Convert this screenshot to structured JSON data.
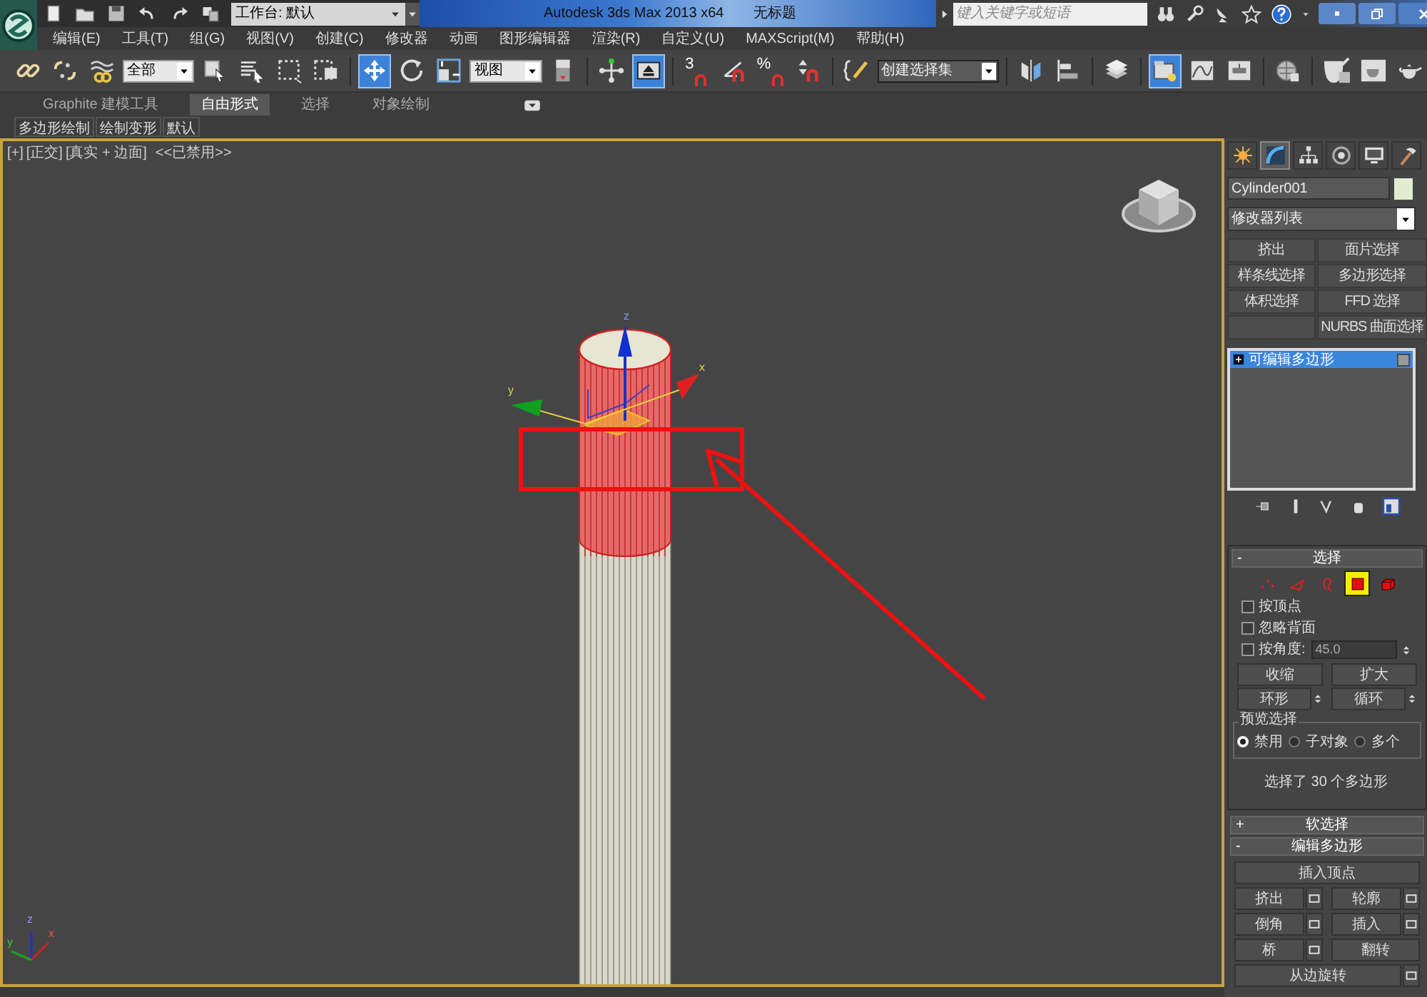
{
  "title_bar": {
    "workspace": "工作台: 默认",
    "app_title": "Autodesk 3ds Max  2013 x64",
    "document": "无标题",
    "search_placeholder": "键入关键字或短语"
  },
  "menu": [
    "编辑(E)",
    "工具(T)",
    "组(G)",
    "视图(V)",
    "创建(C)",
    "修改器",
    "动画",
    "图形编辑器",
    "渲染(R)",
    "自定义(U)",
    "MAXScript(M)",
    "帮助(H)"
  ],
  "toolbar": [
    {
      "kind": "link",
      "selected": false
    },
    {
      "kind": "unlink",
      "selected": false
    },
    {
      "kind": "bind",
      "selected": false
    },
    {
      "kind": "dropdown",
      "value": "全部"
    },
    {
      "kind": "select",
      "selected": false
    },
    {
      "kind": "select-name",
      "selected": false
    },
    {
      "kind": "rect-region",
      "selected": false
    },
    {
      "kind": "window-crossing",
      "selected": false
    },
    {
      "kind": "separator"
    },
    {
      "kind": "move",
      "selected": true
    },
    {
      "kind": "rotate",
      "selected": false
    },
    {
      "kind": "scale",
      "selected": false
    },
    {
      "kind": "dropdown",
      "value": "视图"
    },
    {
      "kind": "pivot",
      "selected": false
    },
    {
      "kind": "separator"
    },
    {
      "kind": "manipulate",
      "selected": false
    },
    {
      "kind": "keyboard",
      "selected": true
    },
    {
      "kind": "separator"
    },
    {
      "kind": "snap",
      "text": "3",
      "selected": false
    },
    {
      "kind": "angle-snap",
      "selected": false
    },
    {
      "kind": "snap",
      "text": "%",
      "selected": false
    },
    {
      "kind": "spinner-snap",
      "selected": false
    },
    {
      "kind": "separator"
    },
    {
      "kind": "named-sel",
      "selected": false
    },
    {
      "kind": "set-dropdown",
      "value": "创建选择集"
    },
    {
      "kind": "separator"
    },
    {
      "kind": "mirror",
      "selected": false
    },
    {
      "kind": "align",
      "selected": false
    },
    {
      "kind": "separator"
    },
    {
      "kind": "layer",
      "selected": false
    },
    {
      "kind": "separator"
    },
    {
      "kind": "scene-explorer",
      "selected": true
    },
    {
      "kind": "curve",
      "selected": false
    },
    {
      "kind": "schematic",
      "selected": false
    },
    {
      "kind": "separator"
    },
    {
      "kind": "material",
      "selected": false
    },
    {
      "kind": "separator"
    },
    {
      "kind": "render-setup",
      "selected": false
    },
    {
      "kind": "frame-window",
      "selected": false
    },
    {
      "kind": "render",
      "selected": false
    }
  ],
  "ribbon": {
    "tabs": [
      {
        "label": "Graphite 建模工具",
        "selected": false
      },
      {
        "label": "自由形式",
        "selected": true
      },
      {
        "label": "选择",
        "selected": false
      },
      {
        "label": "对象绘制",
        "selected": false
      }
    ],
    "subtabs": [
      "多边形绘制",
      "绘制变形",
      "默认"
    ]
  },
  "viewport": {
    "labels": [
      "[+]",
      "[正交]",
      "[真实 + 边面]",
      "<<已禁用>>"
    ],
    "gizmo_labels": [
      "x",
      "y",
      "z"
    ],
    "tripod_labels": [
      "x",
      "y",
      "z"
    ]
  },
  "command_panel": {
    "tabs": [
      {
        "kind": "create",
        "selected": false
      },
      {
        "kind": "modify",
        "selected": true
      },
      {
        "kind": "hierarchy",
        "selected": false
      },
      {
        "kind": "motion",
        "selected": false
      },
      {
        "kind": "display",
        "selected": false
      },
      {
        "kind": "utilities",
        "selected": false
      }
    ],
    "object_name": "Cylinder001",
    "modifier_list": "修改器列表",
    "modifier_buttons": [
      {
        "kind": "button",
        "label": "挤出"
      },
      {
        "kind": "button",
        "label": "面片选择"
      },
      {
        "kind": "button",
        "label": "样条线选择"
      },
      {
        "kind": "button",
        "label": "多边形选择"
      },
      {
        "kind": "button",
        "label": "体积选择"
      },
      {
        "kind": "button",
        "label": "FFD 选择"
      },
      {
        "kind": "blank"
      },
      {
        "kind": "button",
        "label": "NURBS 曲面选择"
      }
    ],
    "stack": [
      {
        "label": "可编辑多边形",
        "selected": true
      }
    ],
    "selection_rollout": {
      "toggle": "-",
      "title": "选择",
      "subobjects": [
        {
          "kind": "vertex",
          "selected": false
        },
        {
          "kind": "edge",
          "selected": false
        },
        {
          "kind": "border",
          "selected": false
        },
        {
          "kind": "polygon",
          "selected": true
        },
        {
          "kind": "element",
          "selected": false
        }
      ],
      "checkboxes": [
        {
          "label": "按顶点",
          "checked": false
        },
        {
          "label": "忽略背面",
          "checked": false
        },
        {
          "label": "按角度:",
          "checked": false,
          "value": "45.0"
        }
      ],
      "buttons": [
        {
          "label": "收缩",
          "spinner": false
        },
        {
          "label": "扩大",
          "spinner": false
        },
        {
          "label": "环形",
          "spinner": true
        },
        {
          "label": "循环",
          "spinner": true
        }
      ],
      "preview": {
        "title": "预览选择",
        "options": [
          {
            "label": "禁用",
            "selected": true
          },
          {
            "label": "子对象",
            "selected": false
          },
          {
            "label": "多个",
            "selected": false
          }
        ]
      },
      "status": "选择了 30 个多边形"
    },
    "soft_rollout": {
      "toggle": "+",
      "title": "软选择"
    },
    "edit_rollout": {
      "toggle": "-",
      "title": "编辑多边形",
      "buttons": [
        {
          "label": "插入顶点",
          "settings": false,
          "full": true
        },
        {
          "label": "挤出",
          "settings": true,
          "full": false
        },
        {
          "label": "轮廓",
          "settings": true,
          "full": false
        },
        {
          "label": "倒角",
          "settings": true,
          "full": false
        },
        {
          "label": "插入",
          "settings": true,
          "full": false
        },
        {
          "label": "桥",
          "settings": true,
          "full": false
        },
        {
          "label": "翻转",
          "settings": false,
          "full": false
        },
        {
          "label": "从边旋转",
          "settings": true,
          "full": true
        }
      ]
    }
  }
}
